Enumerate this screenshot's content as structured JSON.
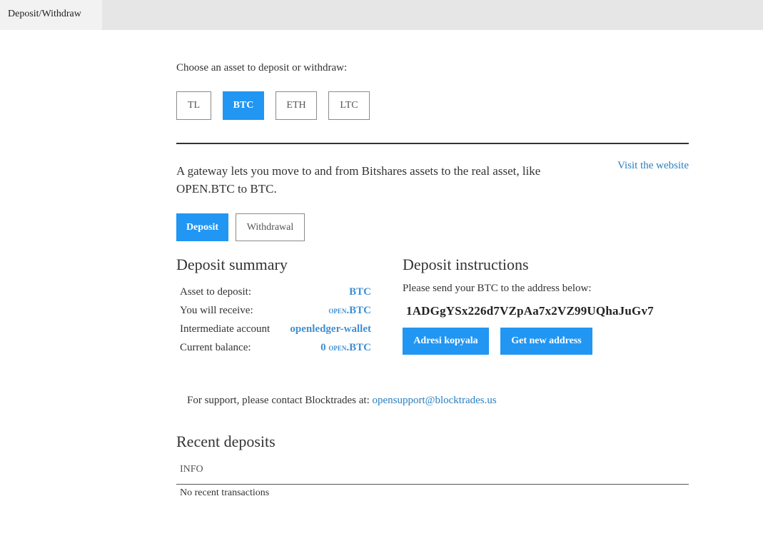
{
  "tabs": [
    {
      "label": "Deposit/Withdraw"
    }
  ],
  "asset_picker": {
    "label": "Choose an asset to deposit or withdraw:",
    "assets": [
      "TL",
      "BTC",
      "ETH",
      "LTC"
    ],
    "selected": "BTC"
  },
  "gateway": {
    "description": "A gateway lets you move to and from Bitshares assets to the real asset, like OPEN.BTC to BTC.",
    "visit_link": "Visit the website"
  },
  "mode": {
    "deposit_label": "Deposit",
    "withdrawal_label": "Withdrawal",
    "selected": "Deposit"
  },
  "summary": {
    "title": "Deposit summary",
    "asset_label": "Asset to deposit:",
    "asset_value": "BTC",
    "receive_label": "You will receive:",
    "receive_prefix": "open",
    "receive_value": ".BTC",
    "intermediate_label": "Intermediate account",
    "intermediate_value": "openledger-wallet",
    "balance_label": "Current balance:",
    "balance_amount": "0",
    "balance_prefix": "open",
    "balance_value": ".BTC"
  },
  "instructions": {
    "title": "Deposit instructions",
    "text": "Please send your BTC to the address below:",
    "address": "1ADGgYSx226d7VZpAa7x2VZ99UQhaJuGv7",
    "copy_label": "Adresi kopyala",
    "new_address_label": "Get new address"
  },
  "support": {
    "text": "For support, please contact Blocktrades at:",
    "email": "opensupport@blocktrades.us"
  },
  "recent": {
    "title": "Recent deposits",
    "column": "INFO",
    "empty": "No recent transactions"
  },
  "colors": {
    "accent": "#2196f3",
    "link": "#2a7fc0",
    "value": "#3f8fd2"
  }
}
